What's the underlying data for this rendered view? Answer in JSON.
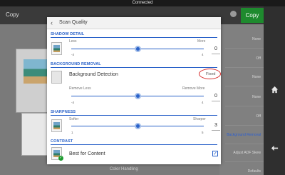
{
  "statusbar": {
    "title": "Connected"
  },
  "background": {
    "toolbar": {
      "left_label": "Copy",
      "copy_button": "Copy"
    },
    "right_items": [
      "None",
      "Off",
      "None",
      "None",
      "Off",
      "Background Removal",
      "Adjust ADF Skew",
      "Defaults"
    ],
    "color_handling": "Color Handling"
  },
  "dialog": {
    "title": "Scan Quality",
    "shadow_detail": {
      "heading": "SHADOW DETAIL",
      "less_label": "Less",
      "more_label": "More",
      "min": "-4",
      "max": "4",
      "value": "0",
      "position": 0.5
    },
    "background_removal": {
      "heading": "BACKGROUND REMOVAL",
      "detection_label": "Background Detection",
      "detection_value": "Fixed",
      "less_label": "Remove Less",
      "more_label": "Remove More",
      "min": "-4",
      "max": "4",
      "value": "0",
      "position": 0.5
    },
    "sharpness": {
      "heading": "SHARPNESS",
      "less_label": "Softer",
      "more_label": "Sharper",
      "min": "1",
      "max": "5",
      "value": "3",
      "position": 0.5
    },
    "contrast": {
      "heading": "CONTRAST",
      "option_label": "Best for Content",
      "checked": true
    }
  },
  "colors": {
    "accent": "#2a62c9",
    "highlight_oval": "#d62a2a",
    "copy_green": "#1e8a2e"
  },
  "icons": [
    "back-arrow-icon",
    "home-icon",
    "back-icon",
    "thumbnail-image-icon",
    "checkmark-icon"
  ]
}
